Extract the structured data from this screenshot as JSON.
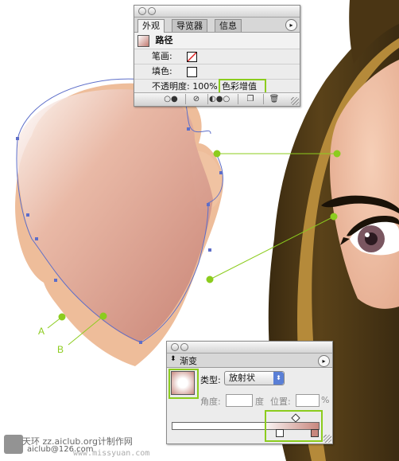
{
  "appearance_panel": {
    "tabs": [
      "外观",
      "导览器",
      "信息"
    ],
    "path_label": "路径",
    "stroke_label": "笔画:",
    "fill_label": "填色:",
    "opacity_label": "不透明度: 100%",
    "blend_mode": "色彩增值",
    "toolbar_icons": [
      "new-art-maintains-appearance-icon",
      "clear-appearance-icon",
      "reduce-to-basic-appearance-icon",
      "duplicate-item-icon",
      "delete-item-icon"
    ]
  },
  "gradient_panel": {
    "title": "渐变",
    "type_label": "类型:",
    "type_value": "放射状",
    "angle_label": "角度:",
    "angle_unit": "度",
    "location_label": "位置:",
    "location_unit": "%",
    "colors": {
      "start": "#ffffff",
      "end": "#c8877e"
    }
  },
  "callouts": {
    "a": "A",
    "b": "B"
  },
  "watermark": {
    "line1": "天环 zz.aiclub.org计制作网",
    "line2": "aiclub@126.com",
    "line3": "www.missyuan.com"
  },
  "colors": {
    "skin": "#eebd9a",
    "skin_shadow": "#c47f72",
    "hair": "#4a3514",
    "callout_line": "#8ccc1e",
    "path": "#5d6ec9"
  }
}
